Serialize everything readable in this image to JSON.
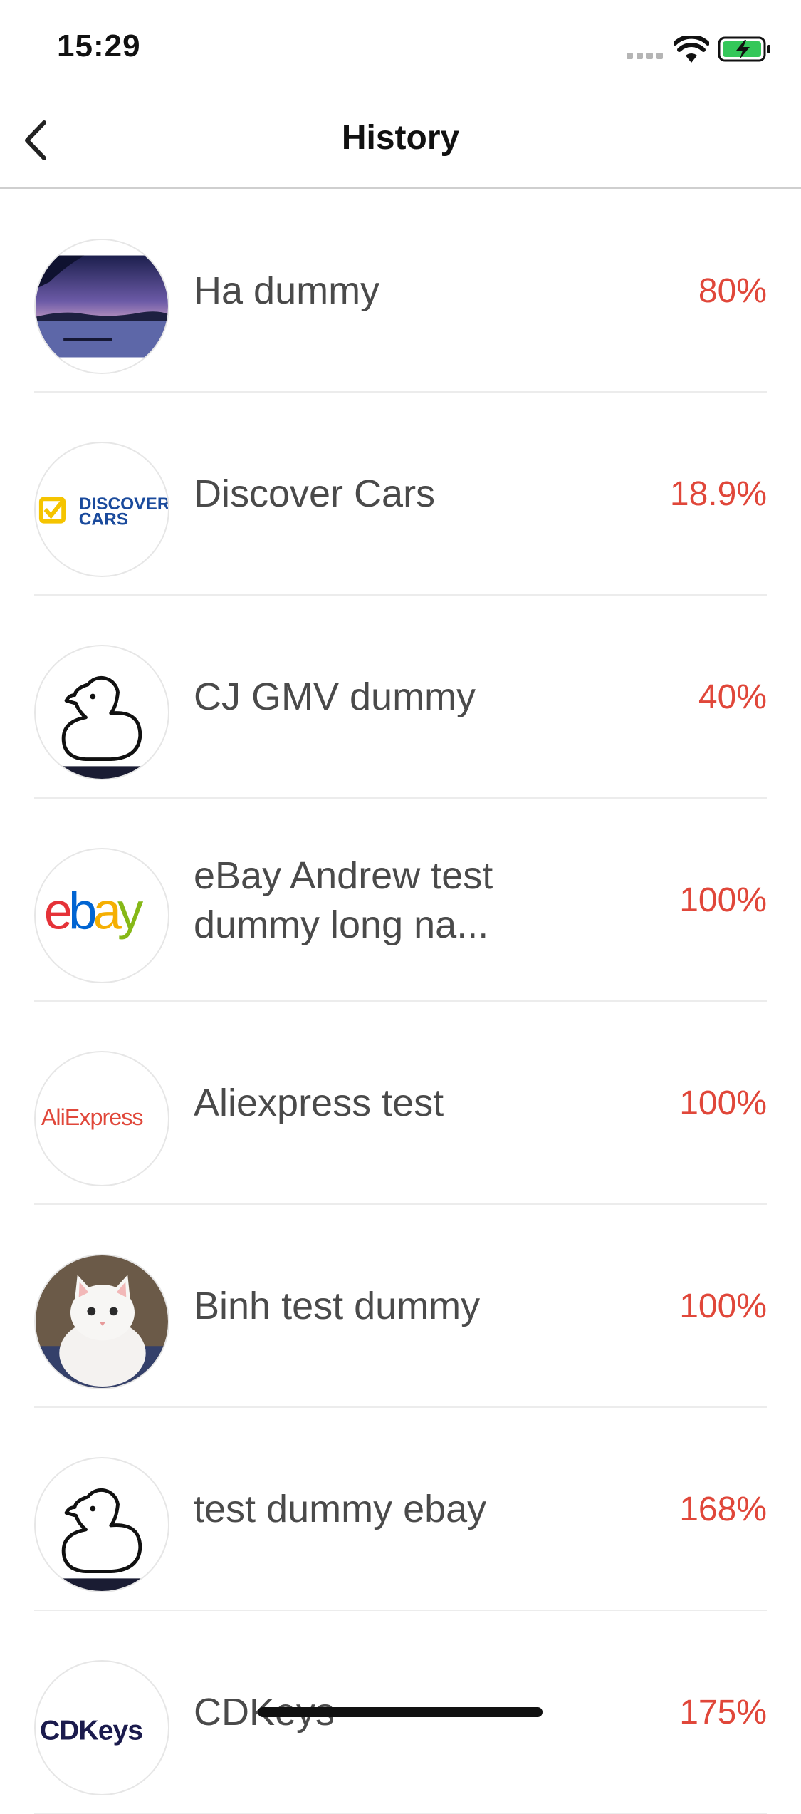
{
  "status_bar": {
    "time": "15:29"
  },
  "nav": {
    "title": "History"
  },
  "list": {
    "items": [
      {
        "name": "Ha dummy",
        "percent": "80%",
        "logo": "lake-sunset-photo"
      },
      {
        "name": "Discover Cars",
        "percent": "18.9%",
        "logo": "discover-cars-logo",
        "logo_text_1": "DISCOVER",
        "logo_text_2": "CARS"
      },
      {
        "name": "CJ GMV dummy",
        "percent": "40%",
        "logo": "duck-icon"
      },
      {
        "name": "eBay Andrew test dummy long na...",
        "percent": "100%",
        "logo": "ebay-logo",
        "logo_text": "ebay"
      },
      {
        "name": "Aliexpress test",
        "percent": "100%",
        "logo": "aliexpress-logo",
        "logo_text": "AliExpress"
      },
      {
        "name": "Binh test dummy",
        "percent": "100%",
        "logo": "white-kitten-photo"
      },
      {
        "name": "test dummy ebay",
        "percent": "168%",
        "logo": "duck-icon"
      },
      {
        "name": "CDKeys",
        "percent": "175%",
        "logo": "cdkeys-logo",
        "logo_text": "CDKeys"
      }
    ]
  },
  "colors": {
    "accent": "#e0473a",
    "text": "#4a4a4a",
    "divider": "#ececec"
  }
}
